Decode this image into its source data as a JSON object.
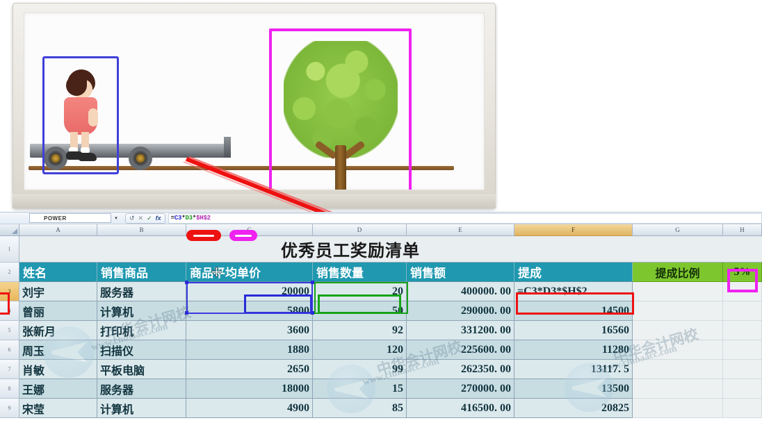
{
  "illustration": {
    "caption": "cart-and-tree-illustration",
    "girl_box_color": "#2a2ad8",
    "tree_box_color": "#ef22ef",
    "arrow_color": "#ee1111"
  },
  "formula_bar": {
    "name_box_value": "POWER",
    "dropdown_icon": "chevron-down-icon",
    "undo_icon": "undo-icon",
    "cancel_icon": "✕",
    "confirm_icon": "✓",
    "function_icon": "fx",
    "formula_parts": [
      {
        "text": "=",
        "color": "#222222"
      },
      {
        "text": "C3",
        "color": "#2b2bd0"
      },
      {
        "text": "*",
        "color": "#222222"
      },
      {
        "text": "D3",
        "color": "#1f9a1f"
      },
      {
        "text": "*",
        "color": "#222222"
      },
      {
        "text": "$H$2",
        "color": "#b42bb4"
      }
    ],
    "formula_text": "=C3*D3*$H$2"
  },
  "spreadsheet": {
    "column_headers": [
      "A",
      "B",
      "C",
      "D",
      "E",
      "F",
      "G",
      "H"
    ],
    "active_column": "F",
    "active_row": "3",
    "row_headers": [
      "1",
      "2",
      "3",
      "4",
      "5",
      "6",
      "7",
      "8",
      "9"
    ],
    "title": "优秀员工奖励清单",
    "table_headers": [
      "姓名",
      "销售商品",
      "商品平均单价",
      "销售数量",
      "销售额",
      "提成"
    ],
    "rate_label": "提成比例",
    "rate_value": "5%",
    "rows": [
      {
        "name": "刘宇",
        "product": "服务器",
        "price": "20000",
        "qty": "20",
        "amount": "400000. 00",
        "bonus": "=C3*D3*$H$2"
      },
      {
        "name": "曾丽",
        "product": "计算机",
        "price": "5800",
        "qty": "50",
        "amount": "290000. 00",
        "bonus": "14500"
      },
      {
        "name": "张新月",
        "product": "打印机",
        "price": "3600",
        "qty": "92",
        "amount": "331200. 00",
        "bonus": "16560"
      },
      {
        "name": "周玉",
        "product": "扫描仪",
        "price": "1880",
        "qty": "120",
        "amount": "225600. 00",
        "bonus": "11280"
      },
      {
        "name": "肖敏",
        "product": "平板电脑",
        "price": "2650",
        "qty": "99",
        "amount": "262350. 00",
        "bonus": "13117. 5"
      },
      {
        "name": "王娜",
        "product": "服务器",
        "price": "18000",
        "qty": "15",
        "amount": "270000. 00",
        "bonus": "13500"
      },
      {
        "name": "宋莹",
        "product": "计算机",
        "price": "4900",
        "qty": "85",
        "amount": "416500. 00",
        "bonus": "20825"
      }
    ]
  },
  "annotations": {
    "price_cell_box_color": "#2a2ad8",
    "qty_cell_box_color": "#17a317",
    "formula_cell_box_color": "#ee1111",
    "rate_cell_box_color": "#ef22ef",
    "header_pill_red": "red-pill-marker",
    "header_pill_magenta": "magenta-pill-marker"
  },
  "watermarks": {
    "text_cn": "中华会计网校",
    "text_url": "www.chinaacc.com"
  }
}
